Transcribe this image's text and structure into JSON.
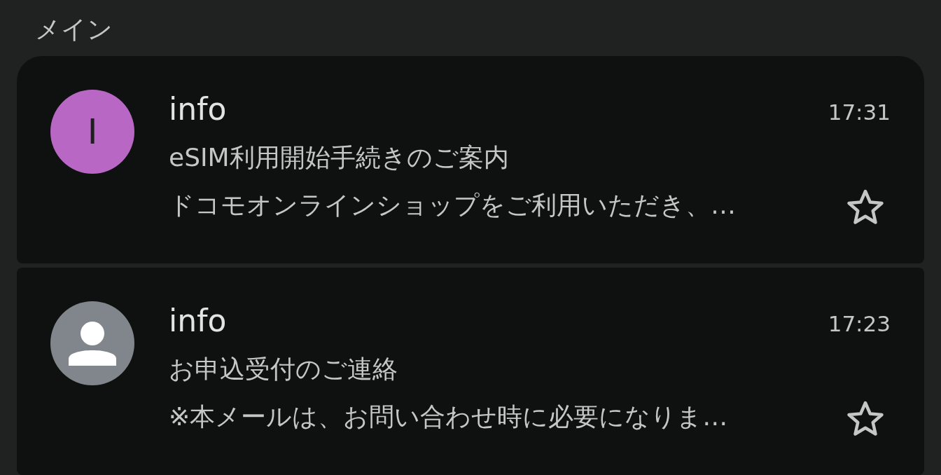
{
  "section_title": "メイン",
  "emails": [
    {
      "avatar": {
        "kind": "letter",
        "letter": "I",
        "color": "#b967c4"
      },
      "sender": "info",
      "time": "17:31",
      "subject": "eSIM利用開始手続きのご案内",
      "preview": "ドコモオンラインショップをご利用いただき、…",
      "starred": false
    },
    {
      "avatar": {
        "kind": "silhouette",
        "color": "#80868b"
      },
      "sender": "info",
      "time": "17:23",
      "subject": "お申込受付のご連絡",
      "preview": "※本メールは、お問い合わせ時に必要になりま…",
      "starred": false
    }
  ]
}
